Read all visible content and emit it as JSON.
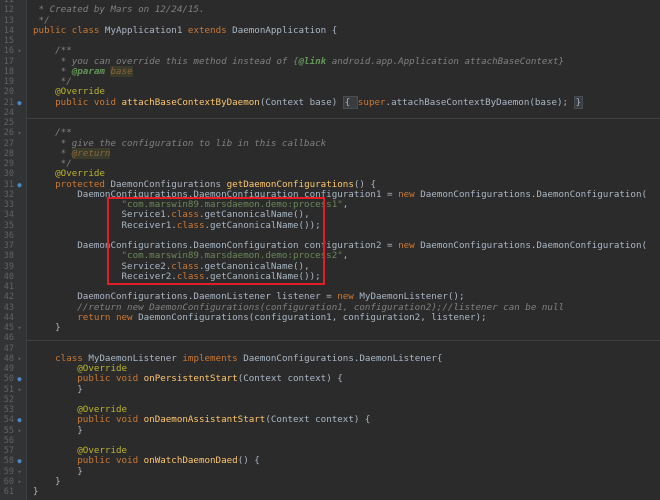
{
  "editor": {
    "lines": [
      {
        "n": "11",
        "segs": [
          {
            "t": "comment",
            "v": " *"
          }
        ]
      },
      {
        "n": "12",
        "segs": [
          {
            "t": "comment",
            "v": " * Created by Mars on 12/24/15."
          }
        ]
      },
      {
        "n": "13",
        "segs": [
          {
            "t": "comment",
            "v": " */"
          }
        ]
      },
      {
        "n": "14",
        "segs": [
          {
            "t": "kw",
            "v": "public class "
          },
          {
            "t": "plain",
            "v": "MyApplication1 "
          },
          {
            "t": "kw",
            "v": "extends "
          },
          {
            "t": "plain",
            "v": "DaemonApplication {"
          }
        ]
      },
      {
        "n": "15",
        "segs": []
      },
      {
        "n": "16",
        "segs": [
          {
            "t": "comment",
            "v": "    /**"
          }
        ]
      },
      {
        "n": "17",
        "segs": [
          {
            "t": "comment",
            "v": "     * you can override this method instead of {"
          },
          {
            "t": "doctag",
            "v": "@link"
          },
          {
            "t": "comment",
            "v": " android.app.Application attachBaseContext}"
          }
        ]
      },
      {
        "n": "18",
        "segs": [
          {
            "t": "comment",
            "v": "     * "
          },
          {
            "t": "doctag",
            "v": "@param"
          },
          {
            "t": "comment",
            "v": " "
          },
          {
            "t": "docval",
            "v": "base"
          }
        ]
      },
      {
        "n": "19",
        "segs": [
          {
            "t": "comment",
            "v": "     */"
          }
        ]
      },
      {
        "n": "20",
        "segs": [
          {
            "t": "ann",
            "v": "    @Override"
          }
        ]
      },
      {
        "n": "21",
        "segs": [
          {
            "t": "kw",
            "v": "    public void "
          },
          {
            "t": "method",
            "v": "attachBaseContextByDaemon"
          },
          {
            "t": "plain",
            "v": "(Context base) "
          },
          {
            "t": "fold",
            "v": "{ "
          },
          {
            "t": "kw",
            "v": "super"
          },
          {
            "t": "plain",
            "v": ".attachBaseContextByDaemon(base); "
          },
          {
            "t": "fold",
            "v": "}"
          }
        ]
      },
      {
        "n": "24",
        "segs": []
      },
      {
        "n": "25",
        "segs": []
      },
      {
        "n": "26",
        "segs": [
          {
            "t": "comment",
            "v": "    /**"
          }
        ]
      },
      {
        "n": "27",
        "segs": [
          {
            "t": "comment",
            "v": "     * give the configuration to lib in this callback"
          }
        ]
      },
      {
        "n": "28",
        "segs": [
          {
            "t": "comment",
            "v": "     * "
          },
          {
            "t": "docval",
            "v": "@return"
          }
        ]
      },
      {
        "n": "29",
        "segs": [
          {
            "t": "comment",
            "v": "     */"
          }
        ]
      },
      {
        "n": "30",
        "segs": [
          {
            "t": "ann",
            "v": "    @Override"
          }
        ]
      },
      {
        "n": "31",
        "segs": [
          {
            "t": "kw",
            "v": "    protected "
          },
          {
            "t": "plain",
            "v": "DaemonConfigurations "
          },
          {
            "t": "method",
            "v": "getDaemonConfigurations"
          },
          {
            "t": "plain",
            "v": "() {"
          }
        ]
      },
      {
        "n": "32",
        "segs": [
          {
            "t": "plain",
            "v": "        DaemonConfigurations.DaemonConfiguration configuration1 = "
          },
          {
            "t": "kw",
            "v": "new "
          },
          {
            "t": "plain",
            "v": "DaemonConfigurations.DaemonConfiguration("
          }
        ]
      },
      {
        "n": "33",
        "segs": [
          {
            "t": "str",
            "v": "                \"com.marswin89.marsdaemon.demo:process1\""
          },
          {
            "t": "plain",
            "v": ","
          }
        ]
      },
      {
        "n": "34",
        "segs": [
          {
            "t": "plain",
            "v": "                Service1."
          },
          {
            "t": "kw",
            "v": "class"
          },
          {
            "t": "plain",
            "v": ".getCanonicalName(),"
          }
        ]
      },
      {
        "n": "35",
        "segs": [
          {
            "t": "plain",
            "v": "                Receiver1."
          },
          {
            "t": "kw",
            "v": "class"
          },
          {
            "t": "plain",
            "v": ".getCanonicalName());"
          }
        ]
      },
      {
        "n": "36",
        "segs": []
      },
      {
        "n": "37",
        "segs": [
          {
            "t": "plain",
            "v": "        DaemonConfigurations.DaemonConfiguration configuration2 = "
          },
          {
            "t": "kw",
            "v": "new "
          },
          {
            "t": "plain",
            "v": "DaemonConfigurations.DaemonConfiguration("
          }
        ]
      },
      {
        "n": "38",
        "segs": [
          {
            "t": "str",
            "v": "                \"com.marswin89.marsdaemon.demo:process2\""
          },
          {
            "t": "plain",
            "v": ","
          }
        ]
      },
      {
        "n": "39",
        "segs": [
          {
            "t": "plain",
            "v": "                Service2."
          },
          {
            "t": "kw",
            "v": "class"
          },
          {
            "t": "plain",
            "v": ".getCanonicalName(),"
          }
        ]
      },
      {
        "n": "40",
        "segs": [
          {
            "t": "plain",
            "v": "                Receiver2."
          },
          {
            "t": "kw",
            "v": "class"
          },
          {
            "t": "plain",
            "v": ".getCanonicalName());"
          }
        ]
      },
      {
        "n": "41",
        "segs": []
      },
      {
        "n": "42",
        "segs": [
          {
            "t": "plain",
            "v": "        DaemonConfigurations.DaemonListener listener = "
          },
          {
            "t": "kw",
            "v": "new "
          },
          {
            "t": "plain",
            "v": "MyDaemonListener();"
          }
        ]
      },
      {
        "n": "43",
        "segs": [
          {
            "t": "comment",
            "v": "        //return new DaemonConfigurations(configuration1, configuration2);//listener can be null"
          }
        ]
      },
      {
        "n": "44",
        "segs": [
          {
            "t": "kw",
            "v": "        return new "
          },
          {
            "t": "plain",
            "v": "DaemonConfigurations(configuration1, configuration2, listener);"
          }
        ]
      },
      {
        "n": "45",
        "segs": [
          {
            "t": "plain",
            "v": "    }"
          }
        ]
      },
      {
        "n": "46",
        "segs": []
      },
      {
        "n": "47",
        "segs": []
      },
      {
        "n": "48",
        "segs": [
          {
            "t": "kw",
            "v": "    class "
          },
          {
            "t": "plain",
            "v": "MyDaemonListener "
          },
          {
            "t": "kw",
            "v": "implements "
          },
          {
            "t": "plain",
            "v": "DaemonConfigurations.DaemonListener{"
          }
        ]
      },
      {
        "n": "49",
        "segs": [
          {
            "t": "ann",
            "v": "        @Override"
          }
        ]
      },
      {
        "n": "50",
        "segs": [
          {
            "t": "kw",
            "v": "        public void "
          },
          {
            "t": "method",
            "v": "onPersistentStart"
          },
          {
            "t": "plain",
            "v": "(Context context) {"
          }
        ]
      },
      {
        "n": "51",
        "segs": [
          {
            "t": "plain",
            "v": "        }"
          }
        ]
      },
      {
        "n": "52",
        "segs": []
      },
      {
        "n": "53",
        "segs": [
          {
            "t": "ann",
            "v": "        @Override"
          }
        ]
      },
      {
        "n": "54",
        "segs": [
          {
            "t": "kw",
            "v": "        public void "
          },
          {
            "t": "method",
            "v": "onDaemonAssistantStart"
          },
          {
            "t": "plain",
            "v": "(Context context) {"
          }
        ]
      },
      {
        "n": "55",
        "segs": [
          {
            "t": "plain",
            "v": "        }"
          }
        ]
      },
      {
        "n": "56",
        "segs": []
      },
      {
        "n": "57",
        "segs": [
          {
            "t": "ann",
            "v": "        @Override"
          }
        ]
      },
      {
        "n": "58",
        "segs": [
          {
            "t": "kw",
            "v": "        public void "
          },
          {
            "t": "method",
            "v": "onWatchDaemonDaed"
          },
          {
            "t": "plain",
            "v": "() {"
          }
        ]
      },
      {
        "n": "59",
        "segs": [
          {
            "t": "plain",
            "v": "        }"
          }
        ]
      },
      {
        "n": "60",
        "segs": [
          {
            "t": "plain",
            "v": "    }"
          }
        ]
      },
      {
        "n": "61",
        "segs": [
          {
            "t": "plain",
            "v": "}"
          }
        ]
      }
    ],
    "gutter_marks": {
      "21": "override-icon",
      "31": "override-icon",
      "50": "override-icon",
      "54": "override-icon",
      "58": "override-icon",
      "16": "fold-icon",
      "26": "fold-icon",
      "48": "fold-icon",
      "45": "fold-icon",
      "51": "fold-icon",
      "55": "fold-icon",
      "59": "fold-icon",
      "60": "fold-icon"
    },
    "highlight": {
      "color": "#e21e26",
      "lines": [
        "33",
        "40"
      ]
    },
    "colors": {
      "background": "#2b2b2b",
      "keyword": "#cc7832",
      "string": "#6a8759",
      "comment": "#808080",
      "annotation": "#bbb529",
      "method": "#ffc66d",
      "plain": "#a9b7c6"
    }
  }
}
